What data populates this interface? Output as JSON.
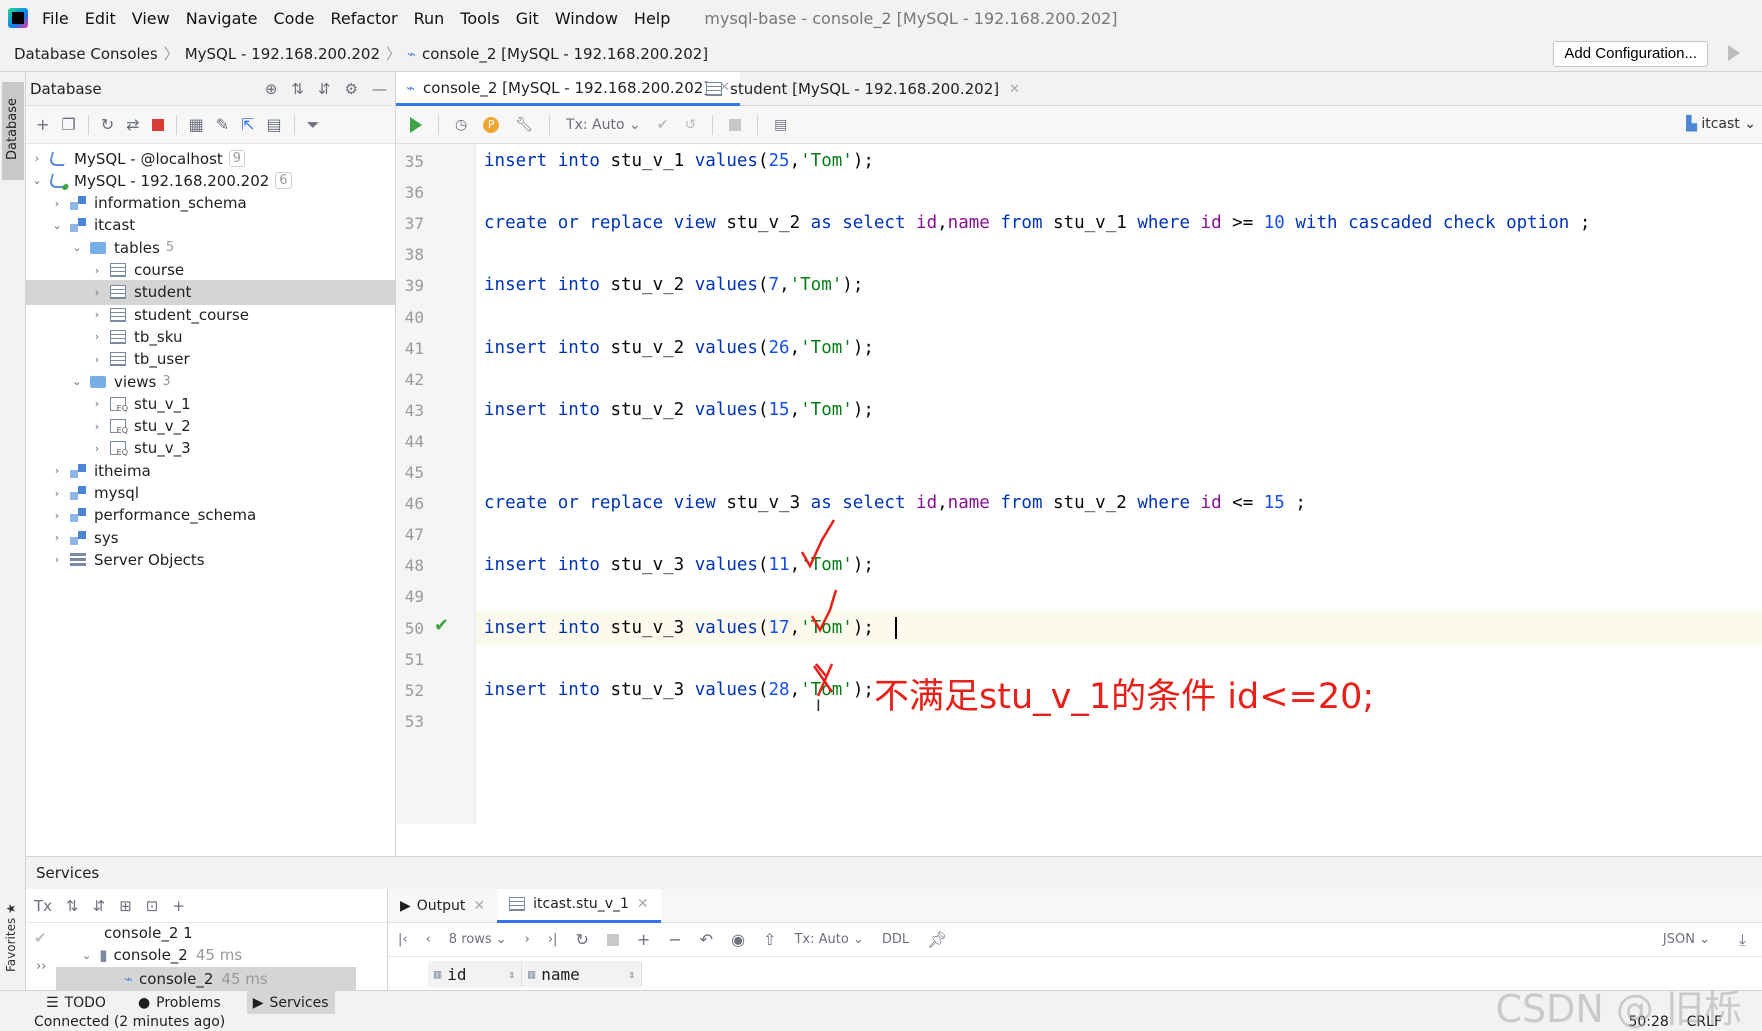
{
  "menu": [
    "File",
    "Edit",
    "View",
    "Navigate",
    "Code",
    "Refactor",
    "Run",
    "Tools",
    "Git",
    "Window",
    "Help"
  ],
  "window_title": "mysql-base - console_2 [MySQL - 192.168.200.202]",
  "breadcrumbs": [
    "Database Consoles",
    "MySQL - 192.168.200.202",
    "console_2 [MySQL - 192.168.200.202]"
  ],
  "add_configuration": "Add Configuration...",
  "stripe": {
    "database": "Database",
    "favorites": "Favorites"
  },
  "db_panel": {
    "title": "Database",
    "tree": [
      {
        "label": "MySQL - @localhost",
        "count": "9",
        "level": 0,
        "icon": "mysql-icon",
        "chev": "›"
      },
      {
        "label": "MySQL - 192.168.200.202",
        "count": "6",
        "level": 0,
        "icon": "mysql-connected-icon",
        "chev": "⌄"
      },
      {
        "label": "information_schema",
        "count": "",
        "level": 1,
        "icon": "schema-icon",
        "chev": "›"
      },
      {
        "label": "itcast",
        "count": "",
        "level": 1,
        "icon": "schema-icon",
        "chev": "⌄"
      },
      {
        "label": "tables",
        "count": "5",
        "level": 2,
        "icon": "folder-icon",
        "chev": "⌄"
      },
      {
        "label": "course",
        "count": "",
        "level": 3,
        "icon": "table-icon",
        "chev": "›"
      },
      {
        "label": "student",
        "count": "",
        "level": 3,
        "icon": "table-icon",
        "chev": "›",
        "selected": true
      },
      {
        "label": "student_course",
        "count": "",
        "level": 3,
        "icon": "table-icon",
        "chev": "›"
      },
      {
        "label": "tb_sku",
        "count": "",
        "level": 3,
        "icon": "table-icon",
        "chev": "›"
      },
      {
        "label": "tb_user",
        "count": "",
        "level": 3,
        "icon": "table-icon",
        "chev": "›"
      },
      {
        "label": "views",
        "count": "3",
        "level": 2,
        "icon": "folder-icon",
        "chev": "⌄"
      },
      {
        "label": "stu_v_1",
        "count": "",
        "level": 3,
        "icon": "view-icon",
        "chev": "›"
      },
      {
        "label": "stu_v_2",
        "count": "",
        "level": 3,
        "icon": "view-icon",
        "chev": "›"
      },
      {
        "label": "stu_v_3",
        "count": "",
        "level": 3,
        "icon": "view-icon",
        "chev": "›"
      },
      {
        "label": "itheima",
        "count": "",
        "level": 1,
        "icon": "schema-icon",
        "chev": "›"
      },
      {
        "label": "mysql",
        "count": "",
        "level": 1,
        "icon": "schema-icon",
        "chev": "›"
      },
      {
        "label": "performance_schema",
        "count": "",
        "level": 1,
        "icon": "schema-icon",
        "chev": "›"
      },
      {
        "label": "sys",
        "count": "",
        "level": 1,
        "icon": "schema-icon",
        "chev": "›"
      },
      {
        "label": "Server Objects",
        "count": "",
        "level": 1,
        "icon": "server-objects-icon",
        "chev": "›"
      }
    ]
  },
  "editor": {
    "tabs": [
      {
        "label": "console_2 [MySQL - 192.168.200.202]",
        "active": true
      },
      {
        "label": "student [MySQL - 192.168.200.202]",
        "active": false
      }
    ],
    "tx_mode": "Tx: Auto",
    "schema": "itcast",
    "line_numbers": [
      "35",
      "36",
      "37",
      "38",
      "39",
      "40",
      "41",
      "42",
      "43",
      "44",
      "45",
      "46",
      "47",
      "48",
      "49",
      "50",
      "51",
      "52",
      "53"
    ],
    "lines": [
      [
        [
          "kw",
          "insert "
        ],
        [
          "kw",
          "into "
        ],
        [
          "plain",
          "stu_v_1 "
        ],
        [
          "kw",
          "values"
        ],
        [
          "plain",
          "("
        ],
        [
          "num",
          "25"
        ],
        [
          "plain",
          ","
        ],
        [
          "str",
          "'Tom'"
        ],
        [
          "plain",
          ");"
        ]
      ],
      [],
      [
        [
          "kw",
          "create "
        ],
        [
          "kw",
          "or "
        ],
        [
          "kw",
          "replace "
        ],
        [
          "kw",
          "view "
        ],
        [
          "plain",
          "stu_v_2 "
        ],
        [
          "kw",
          "as "
        ],
        [
          "kw",
          "select "
        ],
        [
          "col",
          "id"
        ],
        [
          "plain",
          ","
        ],
        [
          "col",
          "name "
        ],
        [
          "kw",
          "from "
        ],
        [
          "plain",
          "stu_v_1 "
        ],
        [
          "kw",
          "where "
        ],
        [
          "col",
          "id "
        ],
        [
          "plain",
          ">= "
        ],
        [
          "num",
          "10 "
        ],
        [
          "kw",
          "with "
        ],
        [
          "kw",
          "cascaded "
        ],
        [
          "kw",
          "check "
        ],
        [
          "kw",
          "option "
        ],
        [
          "plain",
          ";"
        ]
      ],
      [],
      [
        [
          "kw",
          "insert "
        ],
        [
          "kw",
          "into "
        ],
        [
          "plain",
          "stu_v_2 "
        ],
        [
          "kw",
          "values"
        ],
        [
          "plain",
          "("
        ],
        [
          "num",
          "7"
        ],
        [
          "plain",
          ","
        ],
        [
          "str",
          "'Tom'"
        ],
        [
          "plain",
          ");"
        ]
      ],
      [],
      [
        [
          "kw",
          "insert "
        ],
        [
          "kw",
          "into "
        ],
        [
          "plain",
          "stu_v_2 "
        ],
        [
          "kw",
          "values"
        ],
        [
          "plain",
          "("
        ],
        [
          "num",
          "26"
        ],
        [
          "plain",
          ","
        ],
        [
          "str",
          "'Tom'"
        ],
        [
          "plain",
          ");"
        ]
      ],
      [],
      [
        [
          "kw",
          "insert "
        ],
        [
          "kw",
          "into "
        ],
        [
          "plain",
          "stu_v_2 "
        ],
        [
          "kw",
          "values"
        ],
        [
          "plain",
          "("
        ],
        [
          "num",
          "15"
        ],
        [
          "plain",
          ","
        ],
        [
          "str",
          "'Tom'"
        ],
        [
          "plain",
          ");"
        ]
      ],
      [],
      [],
      [
        [
          "kw",
          "create "
        ],
        [
          "kw",
          "or "
        ],
        [
          "kw",
          "replace "
        ],
        [
          "kw",
          "view "
        ],
        [
          "plain",
          "stu_v_3 "
        ],
        [
          "kw",
          "as "
        ],
        [
          "kw",
          "select "
        ],
        [
          "col",
          "id"
        ],
        [
          "plain",
          ","
        ],
        [
          "col",
          "name "
        ],
        [
          "kw",
          "from "
        ],
        [
          "plain",
          "stu_v_2 "
        ],
        [
          "kw",
          "where "
        ],
        [
          "col",
          "id "
        ],
        [
          "plain",
          "<= "
        ],
        [
          "num",
          "15 "
        ],
        [
          "plain",
          ";"
        ]
      ],
      [],
      [
        [
          "kw",
          "insert "
        ],
        [
          "kw",
          "into "
        ],
        [
          "plain",
          "stu_v_3 "
        ],
        [
          "kw",
          "values"
        ],
        [
          "plain",
          "("
        ],
        [
          "num",
          "11"
        ],
        [
          "plain",
          ","
        ],
        [
          "str",
          "'Tom'"
        ],
        [
          "plain",
          ");"
        ]
      ],
      [],
      [
        [
          "kw",
          "insert "
        ],
        [
          "kw",
          "into "
        ],
        [
          "plain",
          "stu_v_3 "
        ],
        [
          "kw",
          "values"
        ],
        [
          "plain",
          "("
        ],
        [
          "num",
          "17"
        ],
        [
          "plain",
          ","
        ],
        [
          "str",
          "'Tom'"
        ],
        [
          "plain",
          ");"
        ]
      ],
      [],
      [
        [
          "kw",
          "insert "
        ],
        [
          "kw",
          "into "
        ],
        [
          "plain",
          "stu_v_3 "
        ],
        [
          "kw",
          "values"
        ],
        [
          "plain",
          "("
        ],
        [
          "num",
          "28"
        ],
        [
          "plain",
          ","
        ],
        [
          "str",
          "'Tom'"
        ],
        [
          "plain",
          ");"
        ]
      ],
      []
    ],
    "annotation": "不满足stu_v_1的条件  id<=20;",
    "annotation_color": "#e8201a"
  },
  "services": {
    "title": "Services",
    "tx": "Tx",
    "tree": [
      {
        "label": "console_2 1",
        "time": ""
      },
      {
        "label": "console_2",
        "time": "45 ms"
      },
      {
        "label": "console_2",
        "time": "45 ms"
      }
    ],
    "tabs": [
      {
        "label": "Output",
        "active": false
      },
      {
        "label": "itcast.stu_v_1",
        "active": true
      }
    ],
    "rows": "8 rows",
    "tx_mode": "Tx: Auto",
    "ddl": "DDL",
    "format": "JSON",
    "columns": [
      "id",
      "name"
    ]
  },
  "bottom_tools": [
    "TODO",
    "Problems",
    "Services"
  ],
  "status": {
    "left": "Connected (2 minutes ago)",
    "position": "50:28",
    "line_sep": "CRLF"
  },
  "watermark": "CSDN @ 旧栎",
  "colors": {
    "accent": "#3574f0",
    "run_green": "#3ca444",
    "selection": "#d5d5d5"
  }
}
